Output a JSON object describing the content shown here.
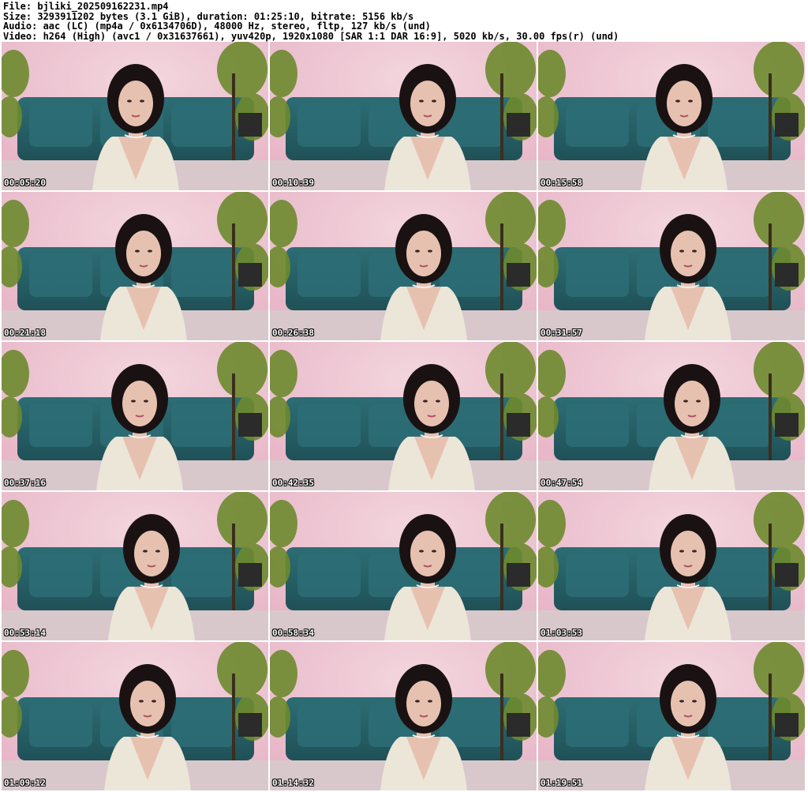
{
  "header": {
    "file": "File: bjliki_202509162231.mp4",
    "size": "Size: 3293911202 bytes (3.1 GiB), duration: 01:25:10, bitrate: 5156 kb/s",
    "audio": "Audio: aac (LC) (mp4a / 0x6134706D), 48000 Hz, stereo, fltp, 127 kb/s (und)",
    "video": "Video: h264 (High) (avc1 / 0x31637661), yuv420p, 1920x1080 [SAR 1:1 DAR 16:9], 5020 kb/s, 30.00 fps(r) (und)"
  },
  "thumbnails": [
    {
      "timestamp": "00:05:20"
    },
    {
      "timestamp": "00:10:39"
    },
    {
      "timestamp": "00:15:58"
    },
    {
      "timestamp": "00:21:18"
    },
    {
      "timestamp": "00:26:38"
    },
    {
      "timestamp": "00:31:57"
    },
    {
      "timestamp": "00:37:16"
    },
    {
      "timestamp": "00:42:35"
    },
    {
      "timestamp": "00:47:54"
    },
    {
      "timestamp": "00:53:14"
    },
    {
      "timestamp": "00:58:34"
    },
    {
      "timestamp": "01:03:53"
    },
    {
      "timestamp": "01:09:12"
    },
    {
      "timestamp": "01:14:32"
    },
    {
      "timestamp": "01:19:51"
    }
  ],
  "colors": {
    "wall": "#e7b4c6",
    "wall_light": "#f3d6de",
    "couch": "#2d6d75",
    "couch_dark": "#1f5157",
    "floor": "#d8c8cc",
    "plant": "#6d8a2e",
    "hair": "#1a1212",
    "skin": "#e7c1b0",
    "cardigan": "#ece6d8"
  }
}
